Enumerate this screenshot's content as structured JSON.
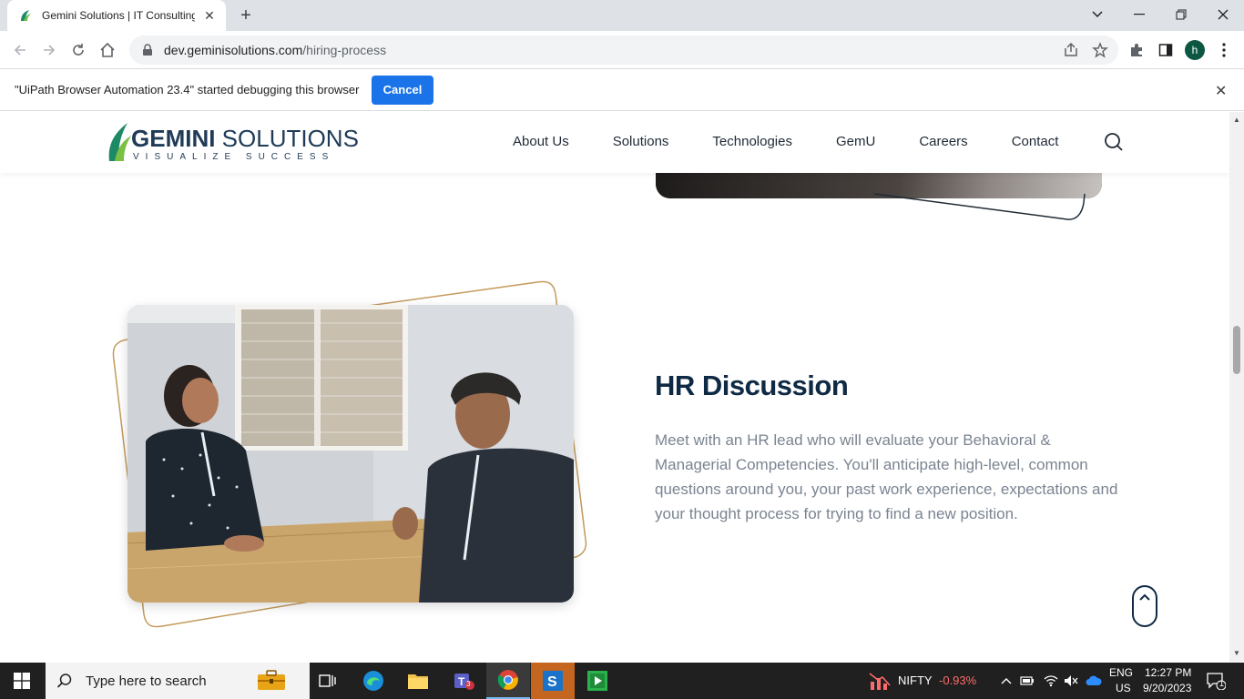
{
  "browser": {
    "tab_title": "Gemini Solutions | IT Consulting",
    "url_host": "dev.geminisolutions.com",
    "url_path": "/hiring-process",
    "profile_initial": "h",
    "infobar_message": "\"UiPath Browser Automation 23.4\" started debugging this browser",
    "infobar_cancel": "Cancel"
  },
  "site": {
    "logo_brand_bold": "GEMINI",
    "logo_brand_rest": " SOLUTIONS",
    "logo_tagline": "VISUALIZE SUCCESS",
    "nav": [
      "About Us",
      "Solutions",
      "Technologies",
      "GemU",
      "Careers",
      "Contact"
    ]
  },
  "section": {
    "title": "HR Discussion",
    "body": "Meet with an HR lead who will evaluate your Behavioral & Managerial Competencies. You'll anticipate high-level, common questions around you, your past work experience, expectations and your thought process for trying to find a new position."
  },
  "taskbar": {
    "search_placeholder": "Type here to search",
    "teams_badge": "3",
    "nifty_label": "NIFTY",
    "nifty_change": "-0.93%",
    "lang_top": "ENG",
    "lang_bottom": "US",
    "time": "12:27 PM",
    "date": "9/20/2023",
    "notification_count": "1"
  },
  "colors": {
    "brand_navy": "#0f2a44",
    "accent_gold": "#c49a5c",
    "chrome_blue": "#1a73e8",
    "nifty_red": "#ff6b6b"
  }
}
